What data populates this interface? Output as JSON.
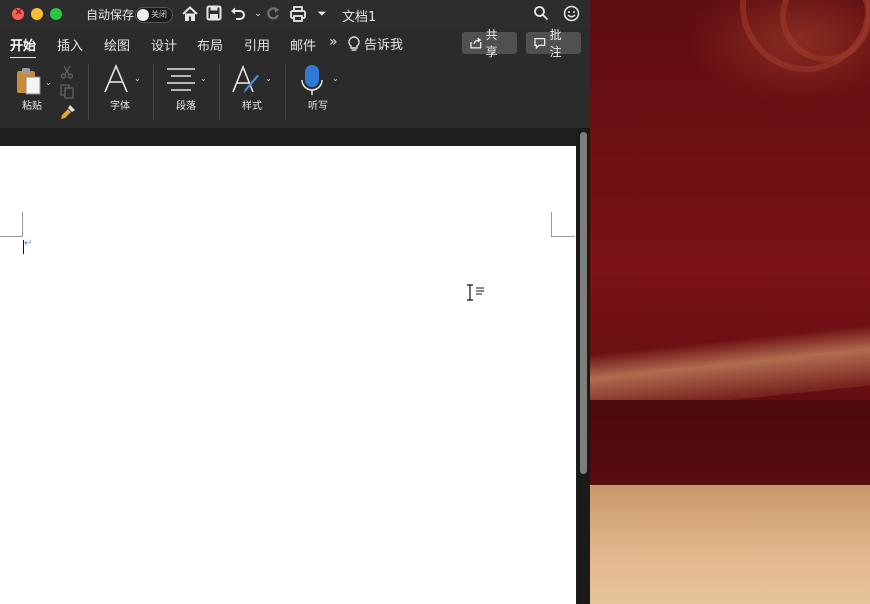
{
  "titlebar": {
    "autosave_label": "自动保存",
    "autosave_state": "关闭",
    "doc_title": "文档1"
  },
  "tabs": [
    {
      "label": "开始",
      "active": true
    },
    {
      "label": "插入"
    },
    {
      "label": "绘图"
    },
    {
      "label": "设计"
    },
    {
      "label": "布局"
    },
    {
      "label": "引用"
    },
    {
      "label": "邮件"
    }
  ],
  "more_tabs": "»",
  "tell_me": "告诉我",
  "share_label": "共享",
  "comment_label": "批注",
  "ribbon": {
    "paste_label": "粘贴",
    "font_label": "字体",
    "paragraph_label": "段落",
    "styles_label": "样式",
    "dictate_label": "听写"
  },
  "icons": {
    "home": "home-icon",
    "save": "save-icon",
    "undo": "undo-icon",
    "redo": "redo-icon",
    "print": "print-icon",
    "customize": "customize-toolbar-icon",
    "search": "search-icon",
    "smiley": "feedback-smiley-icon"
  }
}
